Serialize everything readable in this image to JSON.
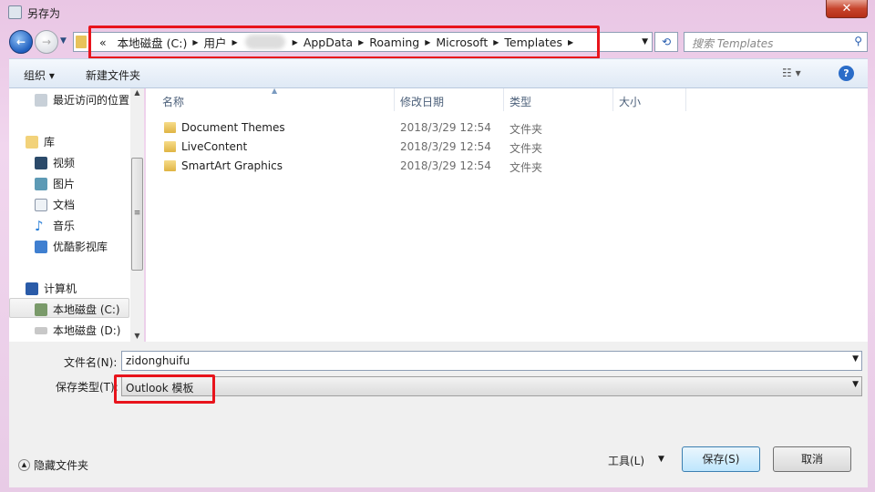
{
  "window": {
    "title": "另存为",
    "close": "✕"
  },
  "nav": {
    "breadcrumb": [
      "本地磁盘 (C:)",
      "用户",
      "AppData",
      "Roaming",
      "Microsoft",
      "Templates"
    ],
    "overflow": "«",
    "search_placeholder": "搜索 Templates"
  },
  "toolbar": {
    "organize": "组织 ▾",
    "new_folder": "新建文件夹",
    "view": "☷ ▾",
    "help": "?"
  },
  "sidebar": {
    "recent": "最近访问的位置",
    "libraries": "库",
    "videos": "视频",
    "pictures": "图片",
    "documents": "文档",
    "music": "音乐",
    "youku": "优酷影视库",
    "computer": "计算机",
    "drive_c": "本地磁盘 (C:)",
    "drive_d": "本地磁盘 (D:)"
  },
  "columns": {
    "name": "名称",
    "modified": "修改日期",
    "type": "类型",
    "size": "大小"
  },
  "files": [
    {
      "name": "Document Themes",
      "modified": "2018/3/29 12:54",
      "type": "文件夹"
    },
    {
      "name": "LiveContent",
      "modified": "2018/3/29 12:54",
      "type": "文件夹"
    },
    {
      "name": "SmartArt Graphics",
      "modified": "2018/3/29 12:54",
      "type": "文件夹"
    }
  ],
  "form": {
    "filename_label": "文件名(N):",
    "filename_value": "zidonghuifu",
    "filetype_label": "保存类型(T):",
    "filetype_value": "Outlook 模板"
  },
  "footer": {
    "hide_folders": "隐藏文件夹",
    "tools": "工具(L)",
    "save": "保存(S)",
    "cancel": "取消"
  },
  "colors": {
    "highlight": "#e8141c"
  }
}
